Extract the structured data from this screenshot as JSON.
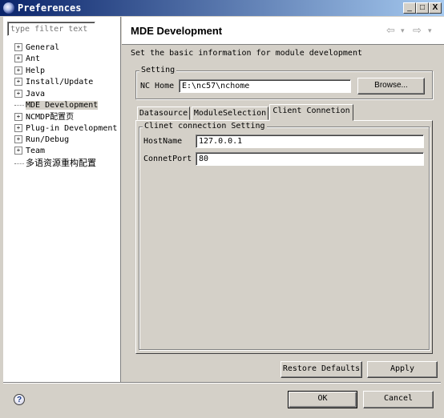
{
  "window": {
    "title": "Preferences",
    "controls": {
      "minimize": "_",
      "maximize": "□",
      "close": "X"
    }
  },
  "sidebar": {
    "filter_placeholder": "type filter text",
    "items": [
      {
        "label": "General",
        "expandable": true,
        "expander": "+"
      },
      {
        "label": "Ant",
        "expandable": true,
        "expander": "+"
      },
      {
        "label": "Help",
        "expandable": true,
        "expander": "+"
      },
      {
        "label": "Install/Update",
        "expandable": true,
        "expander": "+"
      },
      {
        "label": "Java",
        "expandable": true,
        "expander": "+"
      },
      {
        "label": "MDE Development",
        "expandable": false,
        "selected": true
      },
      {
        "label": "NCMDP配置页",
        "expandable": true,
        "expander": "+"
      },
      {
        "label": "Plug-in Development",
        "expandable": true,
        "expander": "+"
      },
      {
        "label": "Run/Debug",
        "expandable": true,
        "expander": "+"
      },
      {
        "label": "Team",
        "expandable": true,
        "expander": "+"
      },
      {
        "label": "多语资源重构配置",
        "expandable": false
      }
    ]
  },
  "page": {
    "title": "MDE Development",
    "nav": {
      "back": "⇦",
      "back_menu": "▾",
      "forward": "⇨",
      "forward_menu": "▾"
    },
    "description": "Set the basic information for module development",
    "setting_group": {
      "legend": "Setting",
      "nc_home_label": "NC Home",
      "nc_home_value": "E:\\nc57\\nchome",
      "browse_button": "Browse..."
    },
    "tabs": [
      {
        "label": "Datasource",
        "active": false
      },
      {
        "label": "ModuleSelection",
        "active": false
      },
      {
        "label": "Client Connetion",
        "active": true
      }
    ],
    "client_group": {
      "legend": "Clinet connection Setting",
      "host_label": "HostName",
      "host_value": "127.0.0.1",
      "port_label": "ConnetPort",
      "port_value": "80"
    },
    "restore_defaults_button": "Restore Defaults",
    "apply_button": "Apply"
  },
  "footer": {
    "help_icon_glyph": "?",
    "ok_button": "OK",
    "cancel_button": "Cancel"
  },
  "colors": {
    "titlebar_start": "#0a246a",
    "titlebar_end": "#a6caf0",
    "dialog_face": "#d4d0c8"
  }
}
